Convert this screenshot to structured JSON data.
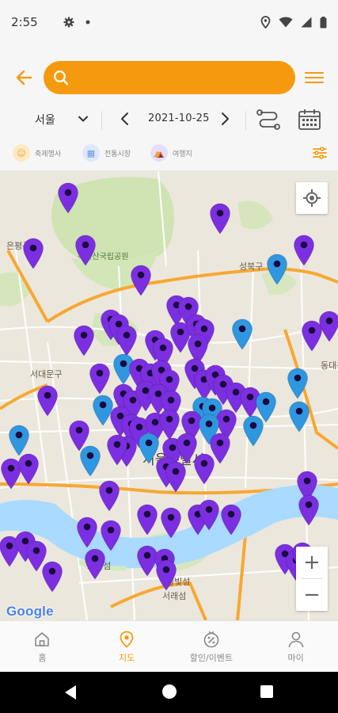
{
  "status_bar": {
    "time": "2:55",
    "icons": [
      "gear-icon",
      "dot-icon",
      "location-icon",
      "wifi-icon",
      "signal-icon",
      "battery-icon"
    ]
  },
  "search": {
    "placeholder": "",
    "accent_color": "#f59a0f"
  },
  "date_bar": {
    "region": "서울",
    "date": "2021-10-25"
  },
  "filters": {
    "items": [
      {
        "label": "축제행사",
        "icon": "smile-icon",
        "color": "#f5c15a"
      },
      {
        "label": "전통시장",
        "icon": "store-icon",
        "color": "#6d97e0"
      },
      {
        "label": "여행지",
        "icon": "tent-icon",
        "color": "#7a5fd6"
      }
    ]
  },
  "map": {
    "labels": [
      "은평구",
      "북한산국립공원",
      "성북구",
      "서대문구",
      "동대문구",
      "서울특별시",
      "노들섬",
      "솔빛섬",
      "서래섬"
    ],
    "marker_colors": {
      "purple": "#7b2fe0",
      "blue": "#2f96e0"
    },
    "attribution": "Google"
  },
  "bottom_nav": {
    "items": [
      {
        "label": "홈",
        "icon": "home-icon",
        "active": false
      },
      {
        "label": "지도",
        "icon": "map-pin-icon",
        "active": true
      },
      {
        "label": "할인/이벤트",
        "icon": "percent-icon",
        "active": false
      },
      {
        "label": "마이",
        "icon": "user-icon",
        "active": false
      }
    ]
  }
}
